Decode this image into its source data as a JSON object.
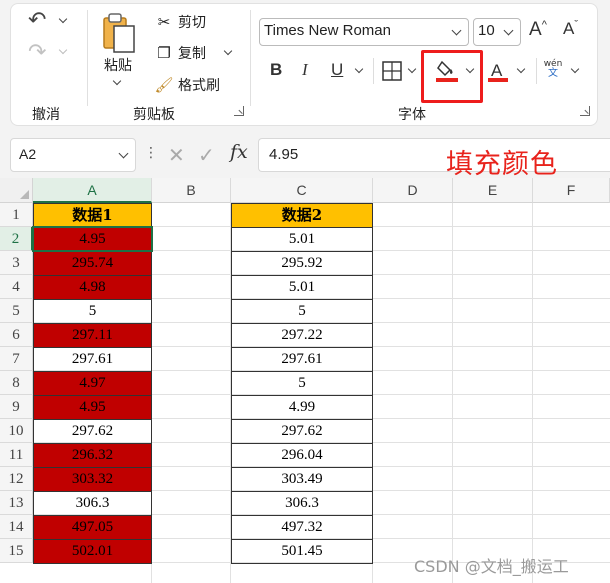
{
  "ribbon": {
    "groups": {
      "undo": "撤消",
      "clipboard": "剪贴板",
      "font": "字体"
    },
    "clipboard": {
      "paste": "粘贴",
      "cut": "剪切",
      "copy": "复制",
      "format_painter": "格式刷"
    },
    "font": {
      "name": "Times New Roman",
      "size": "10",
      "bold": "B",
      "italic": "I",
      "underline": "U",
      "grow": "A",
      "shrink": "A",
      "phonetic_top": "wén",
      "phonetic_bottom": "文"
    },
    "colors": {
      "fill": "#e8231c",
      "font_color": "#e8231c",
      "highlight_box": "#ee1c1c"
    }
  },
  "formula_bar": {
    "name_box": "A2",
    "fx": "fx",
    "value": "4.95"
  },
  "annotation": "填充颜色",
  "grid": {
    "columns": [
      "A",
      "B",
      "C",
      "D",
      "E",
      "F"
    ],
    "rows": [
      "1",
      "2",
      "3",
      "4",
      "5",
      "6",
      "7",
      "8",
      "9",
      "10",
      "11",
      "12",
      "13",
      "14",
      "15"
    ],
    "col_a": [
      {
        "v": "数据1",
        "fill": "header"
      },
      {
        "v": "4.95",
        "fill": "red"
      },
      {
        "v": "295.74",
        "fill": "red"
      },
      {
        "v": "4.98",
        "fill": "red"
      },
      {
        "v": "5",
        "fill": "none"
      },
      {
        "v": "297.11",
        "fill": "red"
      },
      {
        "v": "297.61",
        "fill": "none"
      },
      {
        "v": "4.97",
        "fill": "red"
      },
      {
        "v": "4.95",
        "fill": "red"
      },
      {
        "v": "297.62",
        "fill": "none"
      },
      {
        "v": "296.32",
        "fill": "red"
      },
      {
        "v": "303.32",
        "fill": "red"
      },
      {
        "v": "306.3",
        "fill": "none"
      },
      {
        "v": "497.05",
        "fill": "red"
      },
      {
        "v": "502.01",
        "fill": "red"
      }
    ],
    "col_c": [
      "数据2",
      "5.01",
      "295.92",
      "5.01",
      "5",
      "297.22",
      "297.61",
      "5",
      "4.99",
      "297.62",
      "296.04",
      "303.49",
      "306.3",
      "497.32",
      "501.45"
    ],
    "selected_cell": "A2",
    "colors": {
      "header": "#ffc000",
      "red": "#c00000",
      "selection": "#1e7145"
    }
  },
  "watermark": "CSDN @文档_搬运工"
}
